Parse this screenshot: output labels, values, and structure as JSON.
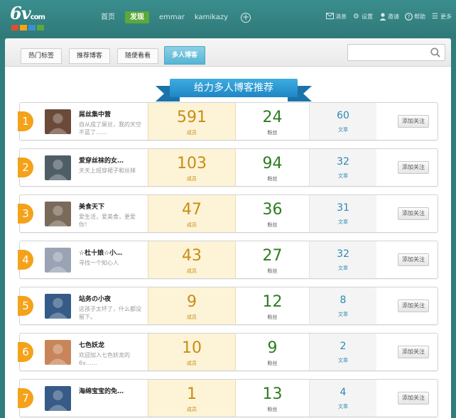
{
  "header": {
    "logo_text": "6v",
    "logo_suffix": "com",
    "logo_colors": [
      "#e24e2a",
      "#f4a21a",
      "#3b8fd0",
      "#5aa93a"
    ],
    "nav": [
      {
        "label": "首页"
      },
      {
        "label": "发现",
        "active": true
      },
      {
        "label": "emmar"
      },
      {
        "label": "kamikazy"
      }
    ],
    "add_label": "+",
    "tools": [
      {
        "icon": "mail-icon",
        "label": "消息"
      },
      {
        "icon": "gear-icon",
        "label": "设置"
      },
      {
        "icon": "user-icon",
        "label": "邀请"
      },
      {
        "icon": "help-icon",
        "label": "帮助"
      },
      {
        "icon": "menu-icon",
        "label": "更多"
      }
    ]
  },
  "tabs": [
    {
      "label": "热门标签"
    },
    {
      "label": "推荐博客"
    },
    {
      "label": "随便看看"
    },
    {
      "label": "多人博客",
      "active": true
    }
  ],
  "search": {
    "placeholder": ""
  },
  "banner": {
    "title": "给力多人博客推荐"
  },
  "labels": {
    "growth": "成员",
    "fans": "粉丝",
    "posts": "文章",
    "follow": "添加关注"
  },
  "rows": [
    {
      "rank": "1",
      "name": "屌丝集中营",
      "desc": "自从成了屌丝，我的天空不蓝了……",
      "growth": "591",
      "fans": "24",
      "posts": "60",
      "avatar_color": "#6b4a3a"
    },
    {
      "rank": "2",
      "name": "爱穿丝袜的女…",
      "desc": "天天上班穿裙子和丝袜",
      "growth": "103",
      "fans": "94",
      "posts": "32",
      "avatar_color": "#4f5e66"
    },
    {
      "rank": "3",
      "name": "美食天下",
      "desc": "爱生活，爱美食，更爱你！",
      "growth": "47",
      "fans": "36",
      "posts": "31",
      "avatar_color": "#7a6a5a"
    },
    {
      "rank": "4",
      "name": "☆杜十娘☆小…",
      "desc": "寻找一个知心人",
      "growth": "43",
      "fans": "27",
      "posts": "32",
      "avatar_color": "#9aa3b3"
    },
    {
      "rank": "5",
      "name": "站务の小夜",
      "desc": "这孩子太坏了，什么都没留下。",
      "growth": "9",
      "fans": "12",
      "posts": "8",
      "avatar_color": "#355b86"
    },
    {
      "rank": "6",
      "name": "七色妖龙",
      "desc": "欢迎加入七色妖龙的6v……",
      "growth": "10",
      "fans": "9",
      "posts": "2",
      "avatar_color": "#c8855a"
    },
    {
      "rank": "7",
      "name": "海绵宝宝的免…",
      "desc": "",
      "growth": "1",
      "fans": "13",
      "posts": "4",
      "avatar_color": "#355b86"
    }
  ]
}
